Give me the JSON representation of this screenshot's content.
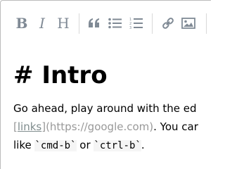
{
  "toolbar": {
    "buttons": [
      {
        "name": "bold",
        "glyph": "B"
      },
      {
        "name": "italic",
        "glyph": "I"
      },
      {
        "name": "heading",
        "glyph": "H"
      },
      {
        "name": "quote",
        "icon": "quote-icon"
      },
      {
        "name": "unordered-list",
        "icon": "unordered-list-icon"
      },
      {
        "name": "ordered-list",
        "icon": "ordered-list-icon"
      },
      {
        "name": "link",
        "icon": "link-icon"
      },
      {
        "name": "image",
        "icon": "image-icon"
      }
    ]
  },
  "editor": {
    "heading": "# Intro",
    "line1": "Go ahead, play around with the ed",
    "line2": {
      "link_open": "[",
      "link_text": "links",
      "link_close": "]",
      "url": "(https://google.com)",
      "rest": ". You car"
    },
    "line3": {
      "prefix": "like ",
      "code1": "`cmd-b`",
      "middle": " or ",
      "code2": "`ctrl-b`",
      "suffix": "."
    }
  },
  "colors": {
    "border": "#bbbbbb",
    "icon": "#2c3e50",
    "muted_text": "#999999",
    "code_bg": "#f5f5f5"
  }
}
